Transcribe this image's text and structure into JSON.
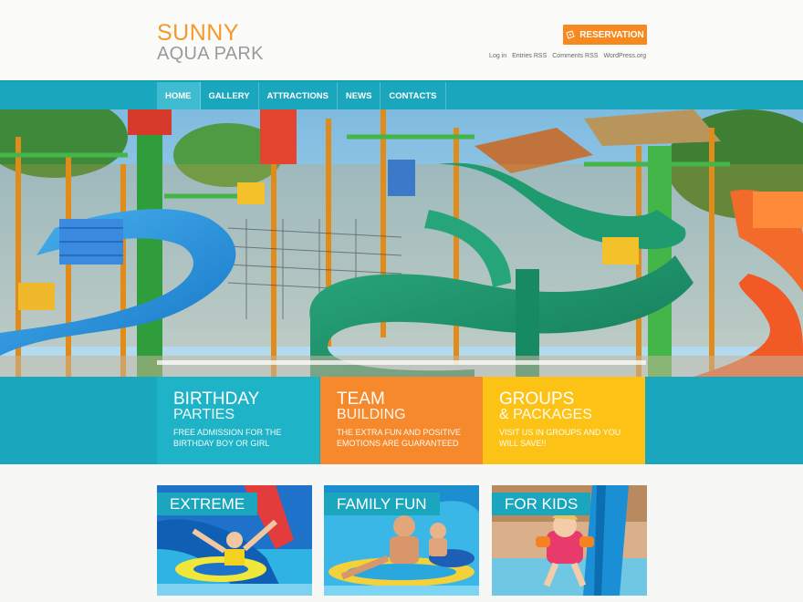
{
  "header": {
    "logo_line1": "SUNNY",
    "logo_line2": "AQUA PARK",
    "reservation_label": "RESERVATION",
    "meta_links": [
      "Log in",
      "Entries RSS",
      "Comments RSS",
      "WordPress.org"
    ]
  },
  "nav": {
    "items": [
      "HOME",
      "GALLERY",
      "ATTRACTIONS",
      "NEWS",
      "CONTACTS"
    ],
    "active": "HOME"
  },
  "features": [
    {
      "title1": "BIRTHDAY",
      "title2": "PARTIES",
      "desc": "FREE ADMISSION FOR THE BIRTHDAY BOY OR GIRL",
      "color": "#1fb3c8"
    },
    {
      "title1": "TEAM",
      "title2": "BUILDING",
      "desc": "THE EXTRA FUN AND POSITIVE EMOTIONS ARE GUARANTEED",
      "color": "#f6892b"
    },
    {
      "title1": "GROUPS",
      "title2": "& PACKAGES",
      "desc": "VISIT US IN GROUPS AND YOU WILL SAVE!!",
      "color": "#fcc316"
    }
  ],
  "thumbs": [
    {
      "label": "EXTREME"
    },
    {
      "label": "FAMILY FUN"
    },
    {
      "label": "FOR KIDS"
    }
  ],
  "colors": {
    "brand_orange": "#f39a2a",
    "button_orange": "#f68a1e",
    "nav_teal": "#1aa6bd",
    "active_tab": "#3fbccf",
    "yellow": "#fcc316"
  },
  "icons": {
    "reservation": "ticket-icon"
  }
}
